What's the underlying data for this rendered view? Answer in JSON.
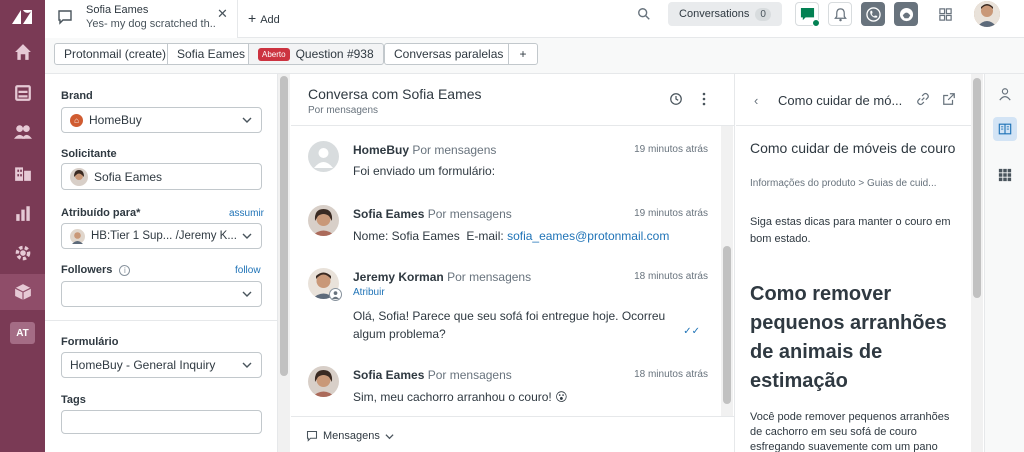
{
  "rail": {
    "nav": [
      "home-icon",
      "views-icon",
      "customers-icon",
      "organizations-icon",
      "reporting-icon",
      "admin-icon",
      "apps-icon"
    ],
    "at_badge": "AT"
  },
  "topbar": {
    "tab_title": "Sofia Eames",
    "tab_subtitle": "Yes- my dog scratched th...",
    "add_label": "Add",
    "conversations_label": "Conversations",
    "conversations_count": "0"
  },
  "subtabs": {
    "protonmail": "Protonmail (create)",
    "requester": "Sofia Eames",
    "status_badge": "Aberto",
    "ticket": "Question #938",
    "side_conversations": "Conversas paralelas",
    "plus": "+"
  },
  "props": {
    "brand_label": "Brand",
    "brand_value": "HomeBuy",
    "requester_label": "Solicitante",
    "requester_value": "Sofia Eames",
    "assignee_label": "Atribuído para*",
    "assignee_link": "assumir",
    "assignee_value": "HB:Tier 1 Sup... /Jeremy K...",
    "followers_label": "Followers",
    "followers_link": "follow",
    "form_label": "Formulário",
    "form_value": "HomeBuy - General Inquiry",
    "tags_label": "Tags"
  },
  "conversation": {
    "title": "Conversa com Sofia Eames",
    "subtitle": "Por mensagens",
    "messages": [
      {
        "author": "HomeBuy",
        "channel": "Por mensagens",
        "time": "19 minutos atrás",
        "body": "Foi enviado um formulário:"
      },
      {
        "author": "Sofia Eames",
        "channel": "Por mensagens",
        "time": "19 minutos atrás",
        "body_prefix": "Nome: Sofia Eames  E-mail: ",
        "email": "sofia_eames@protonmail.com"
      },
      {
        "author": "Jeremy Korman",
        "channel": "Por mensagens",
        "time": "18 minutos atrás",
        "assign": "Atribuir",
        "body": "Olá, Sofia! Parece que seu sofá foi entregue hoje. Ocorreu algum problema?"
      },
      {
        "author": "Sofia Eames",
        "channel": "Por mensagens",
        "time": "18 minutos atrás",
        "body": "Sim, meu cachorro arranhou o couro! 😮"
      }
    ],
    "footer_mode": "Mensagens"
  },
  "kb": {
    "header_title": "Como cuidar de mó...",
    "title": "Como cuidar de móveis de couro",
    "breadcrumb": "Informações do produto > Guias de cuid...",
    "intro": "Siga estas dicas para manter o couro em bom estado.",
    "heading": "Como remover pequenos arranhões de animais de estimação",
    "paragraph": "Você pode remover pequenos arranhões de cachorro em seu sofá de couro esfregando suavemente com um pano"
  },
  "colors": {
    "rail": "#7a3a55",
    "link": "#1f73b7",
    "badge": "#cc3340",
    "chat_green": "#038153"
  }
}
